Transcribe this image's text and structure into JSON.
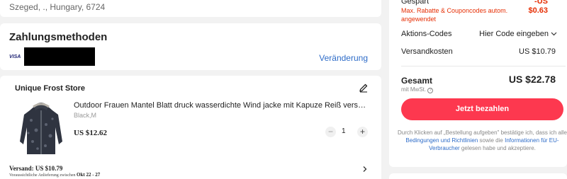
{
  "address": {
    "line": "Szeged, ., Hungary, 6724"
  },
  "payment": {
    "title": "Zahlungsmethoden",
    "card_brand": "VISA",
    "change_label": "Veränderung"
  },
  "store": {
    "name": "Unique Frost Store",
    "product": {
      "title": "Outdoor Frauen Mantel Blatt druck wasserdichte Wind jacke mit Kapuze Reiß verschluss t...",
      "variant": "Black,M",
      "price": "US $12.62",
      "quantity": "1",
      "minus": "−",
      "plus": "+"
    },
    "shipping": {
      "line": "Versand: US $10.79",
      "delivery_prefix": "Voraussichtliche Anlieferung zwischen",
      "delivery_dates": "Okt 22 - 27"
    }
  },
  "summary": {
    "saved_label": "Gespart",
    "saved_value_line1": "-US",
    "saved_value_line2": "$0.63",
    "discount_note": "Max. Rabatte & Couponcodes autom. angewendet",
    "codes_label": "Aktions-Codes",
    "codes_value": "Hier Code eingeben",
    "shipping_label": "Versandkosten",
    "shipping_value": "US $10.79",
    "total_label": "Gesamt",
    "total_value": "US $22.78",
    "vat_note": "mit MwSt.",
    "pay_button": "Jetzt bezahlen",
    "legal_part1": "Durch Klicken auf „Bestellung aufgeben\" bestätige ich, dass ich alle",
    "legal_link1": "Bedingungen und Richtlinien",
    "legal_part2": "sowie die",
    "legal_link2": "Informationen für EU-Verbraucher",
    "legal_part3": "gelesen habe und akzeptiere."
  },
  "icons": {
    "edit": "pencil-icon",
    "chevron_down": "chevron-down-icon",
    "chevron_right": "chevron-right-icon",
    "help": "question-icon"
  },
  "colors": {
    "accent": "#fd384f",
    "saving_red": "#e62e04",
    "link_blue": "#2e6cc8",
    "page_bg": "#f2f2f2"
  }
}
